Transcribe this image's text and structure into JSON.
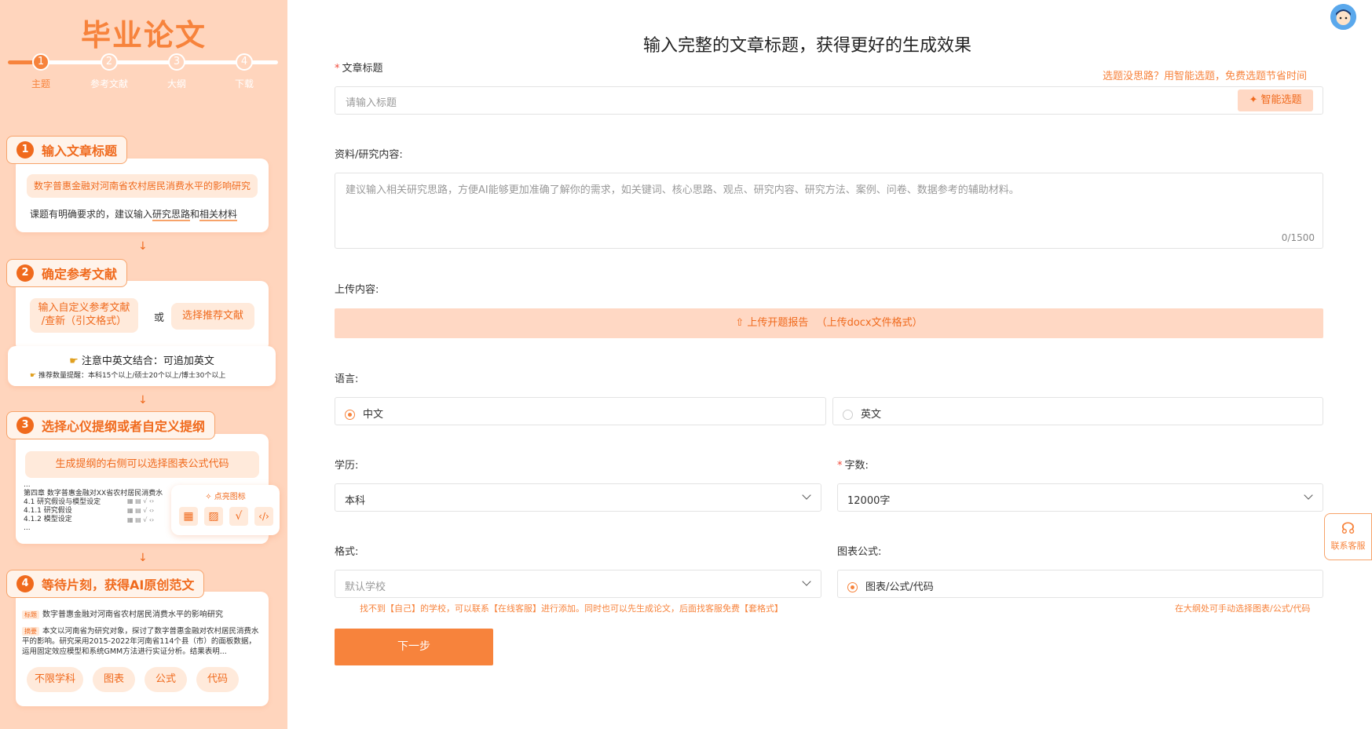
{
  "sidebar": {
    "brand": "毕业论文",
    "steps": [
      {
        "num": "1",
        "label": "主题"
      },
      {
        "num": "2",
        "label": "参考文献"
      },
      {
        "num": "3",
        "label": "大纲"
      },
      {
        "num": "4",
        "label": "下载"
      }
    ],
    "progress_fraction": 0.125,
    "section1": {
      "num": "1",
      "title": "输入文章标题",
      "example": "数字普惠金融对河南省农村居民消费水平的影响研究",
      "tip_prefix": "课题有明确要求的，建议输入",
      "tip_u1": "研究思路",
      "tip_mid": "和",
      "tip_u2": "相关材料"
    },
    "section2": {
      "num": "2",
      "title": "确定参考文献",
      "btn_custom": "输入自定义参考文献\n/查新（引文格式）",
      "or": "或",
      "btn_recommend": "选择推荐文献",
      "note_title": "注意中英文结合：可追加英文",
      "note_sub": "推荐数量提醒：本科15个以上/硕士20个以上/博士30个以上"
    },
    "section3": {
      "num": "3",
      "title": "选择心仪提纲或者自定义提纲",
      "banner": "生成提纲的右侧可以选择图表公式代码",
      "outline": [
        "...",
        "第四章 数字普惠金融对XX省农村居民消费水",
        "4.1 研究假设与模型设定",
        "4.1.1 研究假设",
        "4.1.2 模型设定",
        "..."
      ],
      "highlight_label": "点亮图标"
    },
    "section4": {
      "num": "4",
      "title": "等待片刻，获得AI原创范文",
      "tag_title": "标题",
      "sample_title": "数字普惠金融对河南省农村居民消费水平的影响研究",
      "tag_abstract": "摘要",
      "abstract": "本文以河南省为研究对象，探讨了数字普惠金融对农村居民消费水平的影响。研究采用2015-2022年河南省114个县（市）的面板数据，运用固定效应模型和系统GMM方法进行实证分析。结果表明...",
      "chips": [
        "不限学科",
        "图表",
        "公式",
        "代码"
      ]
    }
  },
  "main": {
    "heading": "输入完整的文章标题，获得更好的生成效果",
    "title_label": "文章标题",
    "title_hint": "选题没思路？用智能选题，免费选题节省时间",
    "title_placeholder": "请输入标题",
    "smart_btn": "智能选题",
    "material_label": "资料/研究内容:",
    "material_placeholder": "建议输入相关研究思路，方便AI能够更加准确了解你的需求，如关键词、核心思路、观点、研究内容、研究方法、案例、问卷、数据参考的辅助材料。",
    "material_counter": "0/1500",
    "upload_label": "上传内容:",
    "upload_btn": "上传开题报告",
    "upload_hint": "（上传docx文件格式）",
    "language_label": "语言:",
    "lang_options": [
      "中文",
      "英文"
    ],
    "degree_label": "学历:",
    "degree_value": "本科",
    "words_label": "字数:",
    "words_value": "12000字",
    "format_label": "格式:",
    "format_placeholder": "默认学校",
    "format_hint": "找不到【自己】的学校，可以联系【在线客服】进行添加。同时也可以先生成论文，后面找客服免费【套格式】",
    "chart_label": "图表公式:",
    "chart_option": "图表/公式/代码",
    "chart_hint": "在大纲处可手动选择图表/公式/代码",
    "next_btn": "下一步"
  },
  "float": {
    "cs_label": "联系客服"
  },
  "colors": {
    "accent": "#f7833c",
    "sidebar_bg": "#ffd5bd",
    "upload_bg": "#ffd8c4"
  }
}
